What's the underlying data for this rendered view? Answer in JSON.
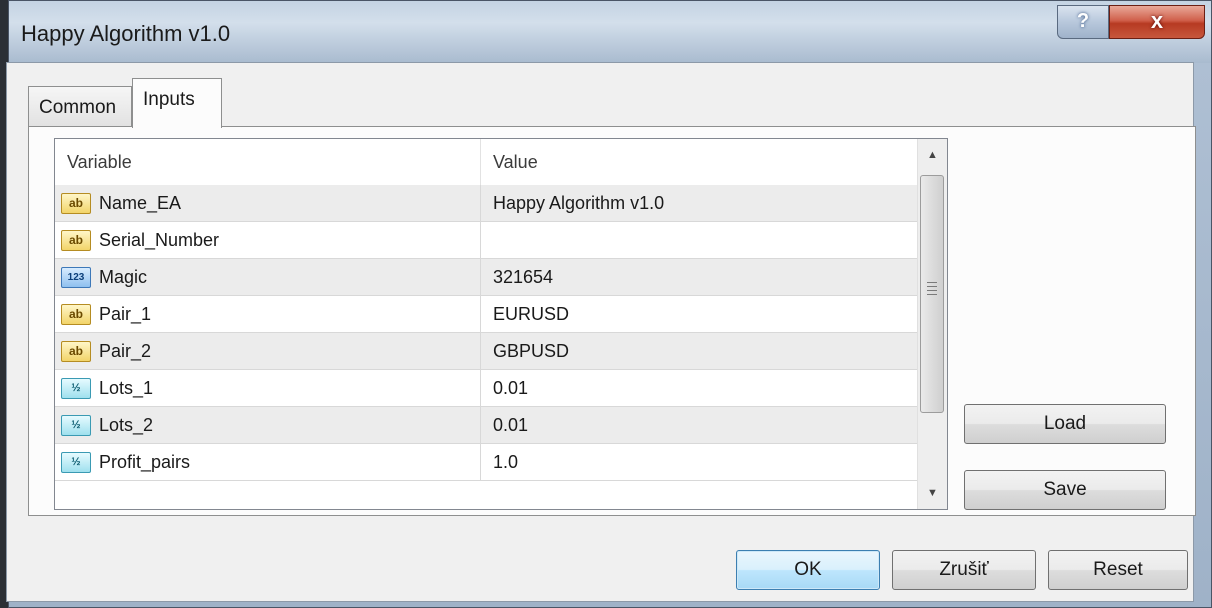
{
  "window": {
    "title": "Happy Algorithm v1.0",
    "help_label": "?",
    "close_label": "x"
  },
  "tabs": [
    {
      "label": "Common",
      "active": false
    },
    {
      "label": "Inputs",
      "active": true
    }
  ],
  "grid": {
    "columns": [
      "Variable",
      "Value"
    ],
    "rows": [
      {
        "type": "string",
        "icon": "ab",
        "name": "Name_EA",
        "value": "Happy Algorithm v1.0"
      },
      {
        "type": "string",
        "icon": "ab",
        "name": "Serial_Number",
        "value": ""
      },
      {
        "type": "integer",
        "icon": "123",
        "name": "Magic",
        "value": "321654"
      },
      {
        "type": "string",
        "icon": "ab",
        "name": "Pair_1",
        "value": "EURUSD"
      },
      {
        "type": "string",
        "icon": "ab",
        "name": "Pair_2",
        "value": "GBPUSD"
      },
      {
        "type": "double",
        "icon": "½",
        "name": "Lots_1",
        "value": "0.01"
      },
      {
        "type": "double",
        "icon": "½",
        "name": "Lots_2",
        "value": "0.01"
      },
      {
        "type": "double",
        "icon": "½",
        "name": "Profit_pairs",
        "value": "1.0"
      }
    ],
    "scroll_position": 0.0
  },
  "buttons": {
    "load": "Load",
    "save": "Save",
    "ok": "OK",
    "cancel": "Zrušiť",
    "reset": "Reset"
  },
  "colors": {
    "close_red": "#c7573d",
    "ok_blue": "#bee6fd",
    "row_alt": "#ececec"
  }
}
